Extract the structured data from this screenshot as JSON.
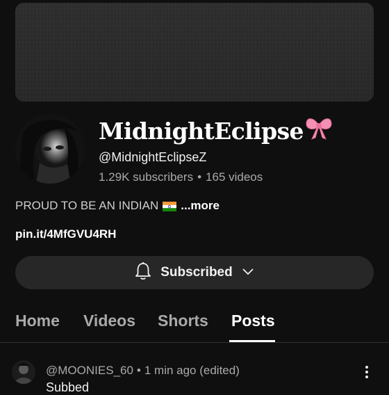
{
  "channel": {
    "name": "MidnightEclipse",
    "name_icon": "ribbon-bow-emoji",
    "handle": "@MidnightEclipseZ",
    "subscribers": "1.29K subscribers",
    "separator": "•",
    "videos": "165 videos",
    "description": "PROUD TO BE AN INDIAN",
    "description_icon": "india-flag",
    "more_label": "...more",
    "link": "pin.it/4MfGVU4RH"
  },
  "subscribe_button": {
    "label": "Subscribed",
    "icon": "bell-icon",
    "dropdown_icon": "chevron-down-icon"
  },
  "tabs": [
    {
      "label": "Home"
    },
    {
      "label": "Videos"
    },
    {
      "label": "Shorts"
    },
    {
      "label": "Posts",
      "active": true
    }
  ],
  "post": {
    "author": "@MOONIES_60",
    "separator": "•",
    "time": "1 min ago (edited)",
    "text": "Subbed",
    "menu_icon": "more-vert-icon"
  },
  "colors": {
    "background": "#0f0f0f",
    "surface": "#272727",
    "text_primary": "#f1f1f1",
    "text_secondary": "#aaaaaa",
    "bow_pink": "#f58fb4"
  }
}
